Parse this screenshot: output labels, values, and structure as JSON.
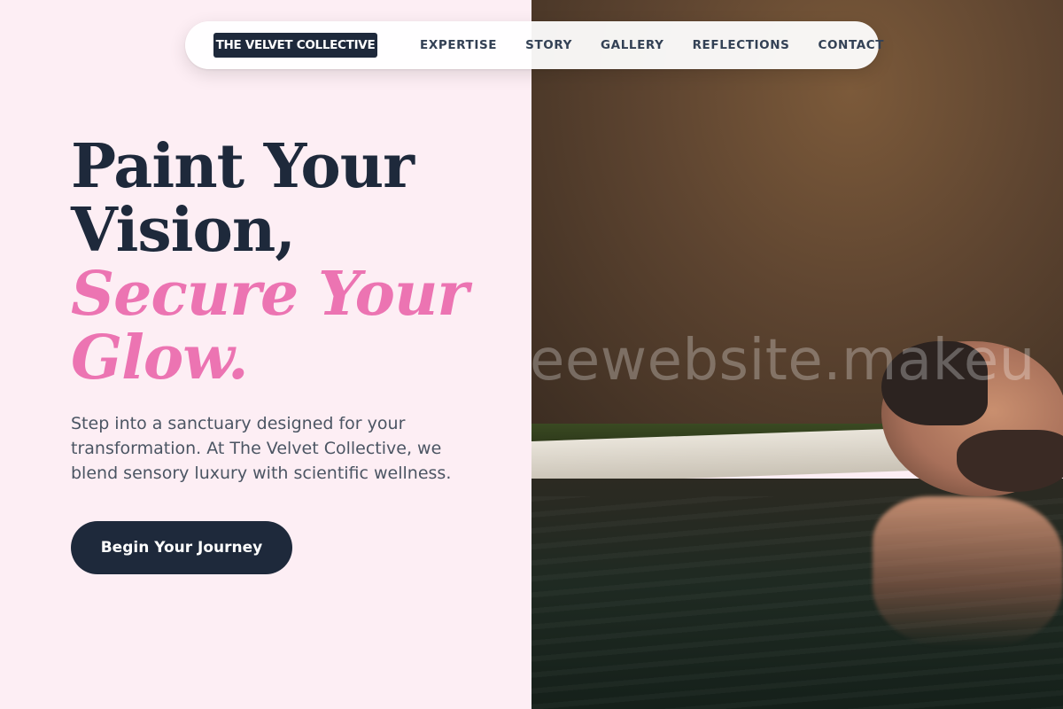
{
  "nav": {
    "brand": "THE VELVET COLLECTIVE",
    "links": [
      {
        "label": "EXPERTISE"
      },
      {
        "label": "STORY"
      },
      {
        "label": "GALLERY"
      },
      {
        "label": "REFLECTIONS"
      },
      {
        "label": "CONTACT"
      }
    ]
  },
  "hero": {
    "headline_line1": "Paint Your",
    "headline_line2": "Vision,",
    "accent_line1": "Secure Your",
    "accent_line2": "Glow.",
    "lead": "Step into a sanctuary designed for your transformation. At The Velvet Collective, we blend sensory luxury with scientific wellness.",
    "cta_label": "Begin Your Journey"
  },
  "photo": {
    "watermark": "eewebsite.makeu"
  },
  "colors": {
    "background": "#fdeef4",
    "navy": "#1e293b",
    "accent_pink": "#ec74b2",
    "body_text": "#4b5563"
  }
}
